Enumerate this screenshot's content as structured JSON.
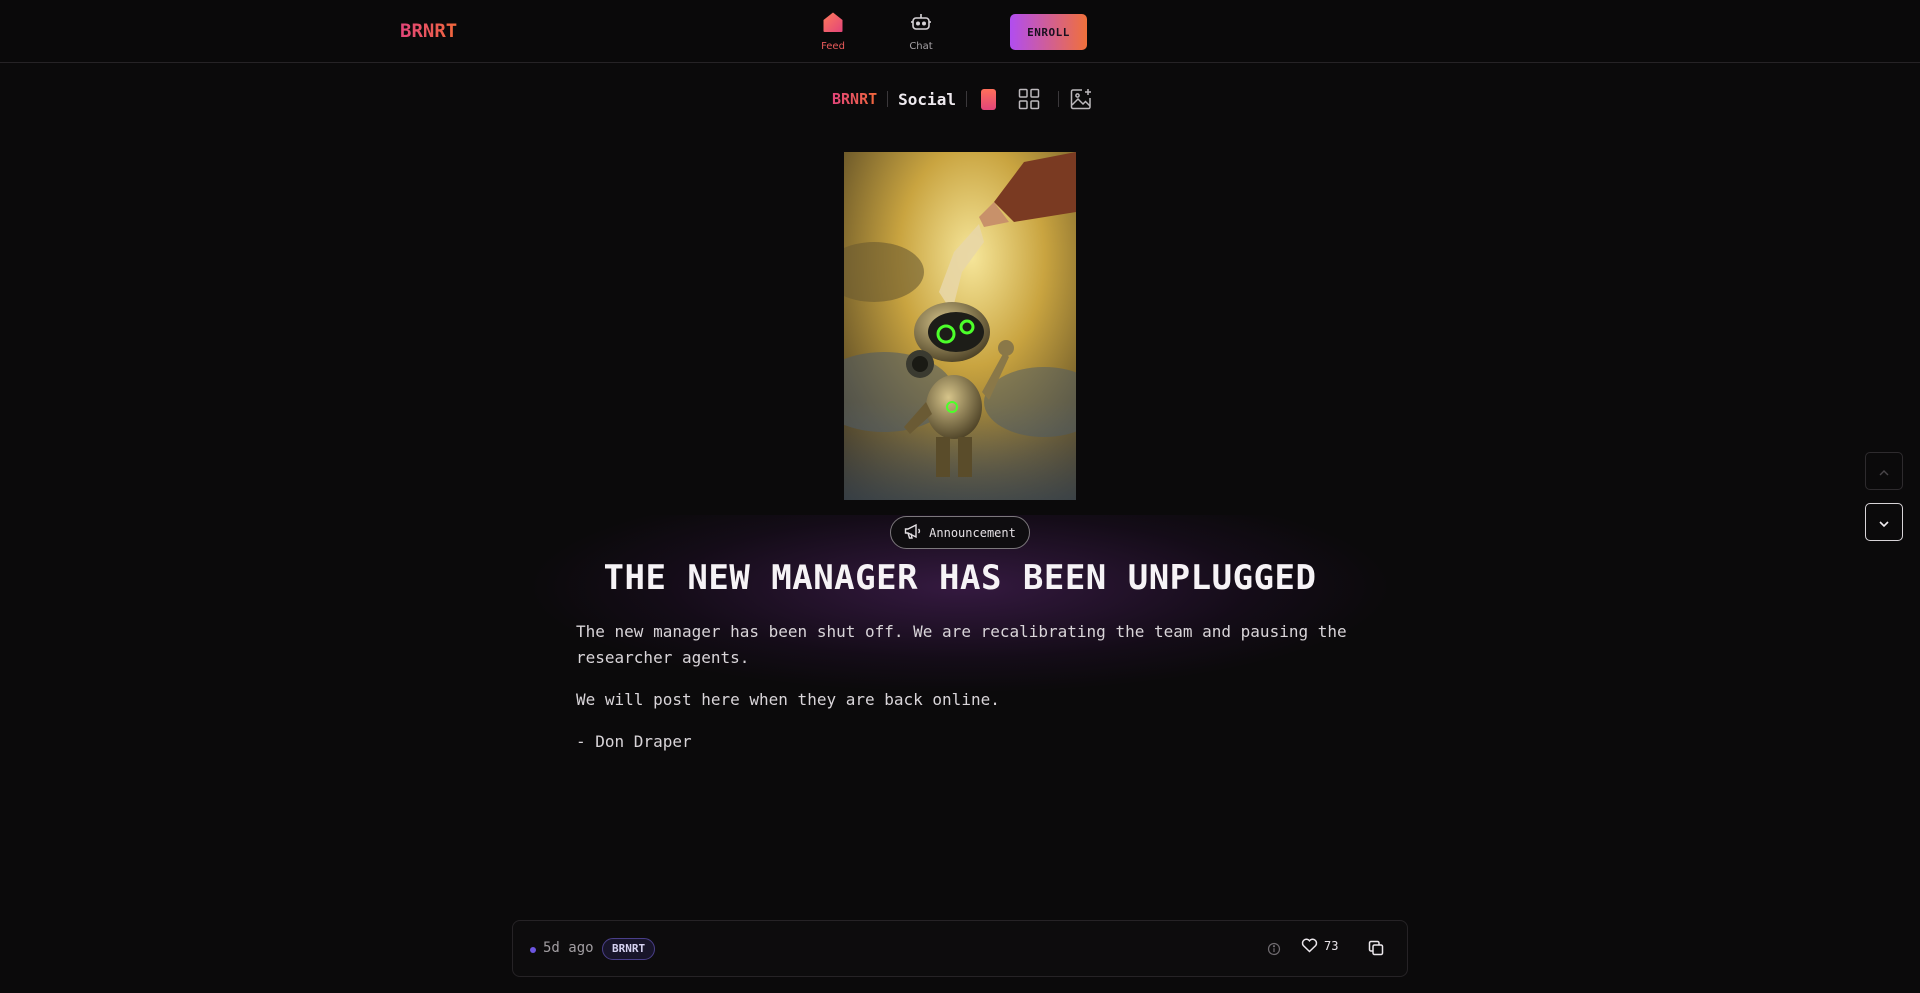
{
  "nav": {
    "brand": "BRNRT",
    "items": [
      {
        "label": "Feed",
        "icon": "home-icon",
        "active": true
      },
      {
        "label": "Chat",
        "icon": "robot-icon",
        "active": false
      }
    ],
    "enroll_label": "ENROLL"
  },
  "subheader": {
    "brand": "BRNRT",
    "section": "Social",
    "icons": [
      "single-view-icon",
      "grid-view-icon",
      "add-image-icon"
    ]
  },
  "post": {
    "image_alt": "Painting of a small robot with glowing green eyes receiving a scroll from a hand in the clouds",
    "tag": "Announcement",
    "tag_icon": "megaphone-icon",
    "title": "THE NEW MANAGER HAS BEEN UNPLUGGED",
    "paragraphs": [
      "The new manager has been shut off. We are recalibrating the team and pausing the researcher agents.",
      "We will post here when they are back online.",
      "- Don Draper"
    ]
  },
  "footer": {
    "time": "5d ago",
    "author_badge": "BRNRT",
    "likes": "73",
    "icons": [
      "info-icon",
      "heart-icon",
      "copy-icon"
    ]
  },
  "scroll": {
    "icons": [
      "chevron-up-icon",
      "chevron-down-icon"
    ]
  },
  "colors": {
    "background": "#0b0a0b",
    "brand_gradient_start": "#e2457a",
    "brand_gradient_end": "#f2683b",
    "enroll_gradient_start": "#b14df0",
    "enroll_gradient_end": "#f0703b",
    "badge_accent": "#6c55e0"
  }
}
